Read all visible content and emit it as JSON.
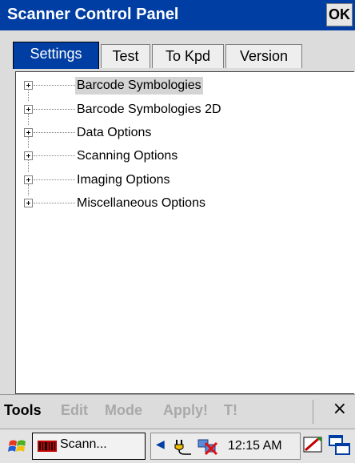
{
  "window": {
    "title": "Scanner Control Panel",
    "ok_label": "OK"
  },
  "tabs": [
    {
      "label": "Settings",
      "active": true
    },
    {
      "label": "Test",
      "active": false
    },
    {
      "label": "To Kpd",
      "active": false
    },
    {
      "label": "Version",
      "active": false
    }
  ],
  "tree": {
    "items": [
      {
        "label": "Barcode Symbologies",
        "selected": true,
        "expander_icon": "plus-box"
      },
      {
        "label": "Barcode Symbologies 2D",
        "selected": false,
        "expander_icon": "plus-box"
      },
      {
        "label": "Data Options",
        "selected": false,
        "expander_icon": "plus-box"
      },
      {
        "label": "Scanning Options",
        "selected": false,
        "expander_icon": "plus-box"
      },
      {
        "label": "Imaging Options",
        "selected": false,
        "expander_icon": "plus-box"
      },
      {
        "label": "Miscellaneous Options",
        "selected": false,
        "expander_icon": "plus-box"
      }
    ]
  },
  "menubar": {
    "tools": "Tools",
    "edit": "Edit",
    "mode": "Mode",
    "apply": "Apply!",
    "t": "T!",
    "close": "×"
  },
  "taskbar": {
    "start_icon": "windows-flag-icon",
    "task_label": "Scann...",
    "tray_arrow": "◀",
    "clock": "12:15 AM",
    "icons": [
      "power-plug-icon",
      "network-disconnected-icon",
      "soft-keyboard-icon",
      "window-switch-icon"
    ]
  },
  "colors": {
    "titlebar": "#003ea3",
    "chrome": "#dcdcdc",
    "active_tab": "#003ea3"
  }
}
